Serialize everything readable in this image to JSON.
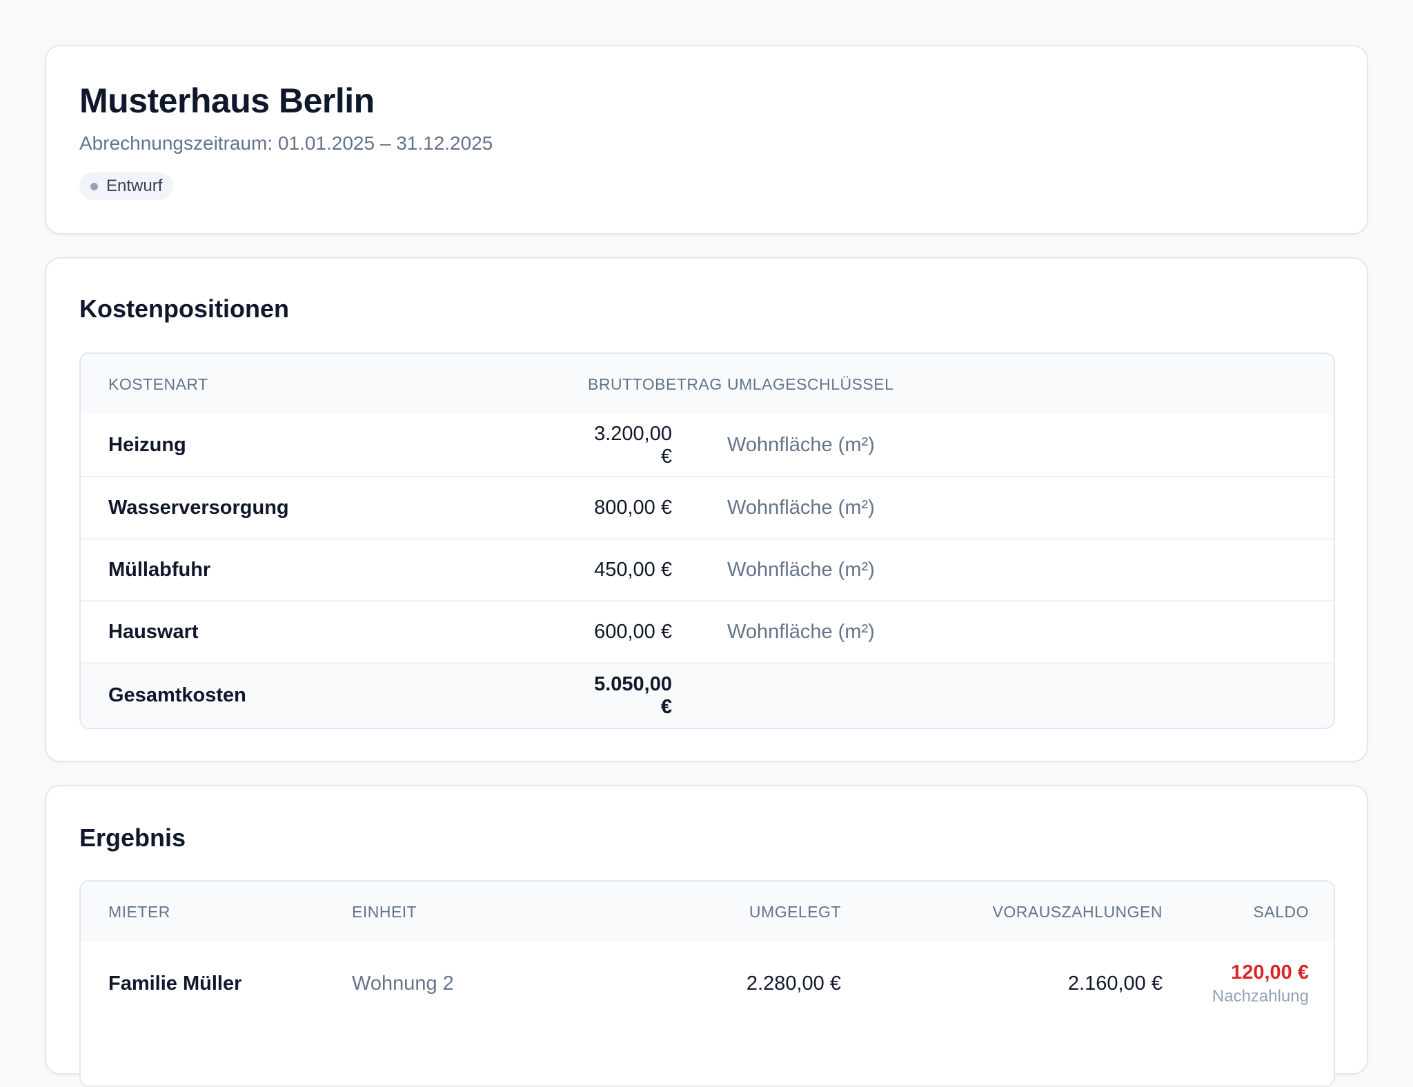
{
  "header": {
    "title": "Musterhaus Berlin",
    "period": "Abrechnungszeitraum: 01.01.2025 – 31.12.2025",
    "status": "Entwurf"
  },
  "costs": {
    "title": "Kostenpositionen",
    "columns": {
      "type": "Kostenart",
      "amount": "Bruttobetrag",
      "key": "Umlageschlüssel"
    },
    "rows": [
      {
        "type": "Heizung",
        "amount": "3.200,00 €",
        "key": "Wohnfläche (m²)"
      },
      {
        "type": "Wasserversorgung",
        "amount": "800,00 €",
        "key": "Wohnfläche (m²)"
      },
      {
        "type": "Müllabfuhr",
        "amount": "450,00 €",
        "key": "Wohnfläche (m²)"
      },
      {
        "type": "Hauswart",
        "amount": "600,00 €",
        "key": "Wohnfläche (m²)"
      }
    ],
    "total": {
      "label": "Gesamtkosten",
      "amount": "5.050,00 €"
    }
  },
  "result": {
    "title": "Ergebnis",
    "columns": {
      "tenant": "Mieter",
      "unit": "Einheit",
      "allocated": "Umgelegt",
      "prepayments": "Vorauszahlungen",
      "balance": "Saldo"
    },
    "rows": [
      {
        "tenant": "Familie Müller",
        "unit": "Wohnung 2",
        "allocated": "2.280,00 €",
        "prepayments": "2.160,00 €",
        "balance": "120,00 €",
        "balance_note": "Nachzahlung"
      }
    ]
  },
  "colors": {
    "background": "#f8f9fa",
    "text": "#0f172a",
    "muted": "#64748b",
    "negative": "#dc2626",
    "badge_bg": "#f1f5f9"
  }
}
